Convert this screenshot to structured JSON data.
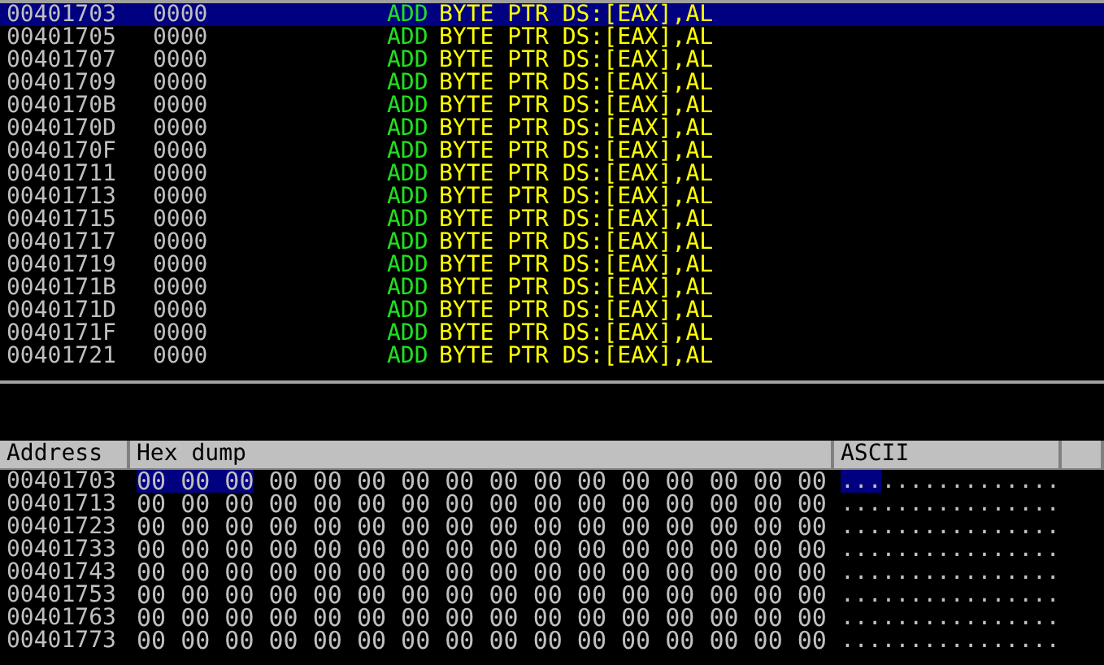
{
  "disassembly": {
    "rows": [
      {
        "address": "00401703",
        "hex": "0000",
        "mnemonic": "ADD",
        "operands": "BYTE PTR DS:[EAX],AL",
        "selected": true
      },
      {
        "address": "00401705",
        "hex": "0000",
        "mnemonic": "ADD",
        "operands": "BYTE PTR DS:[EAX],AL",
        "selected": false
      },
      {
        "address": "00401707",
        "hex": "0000",
        "mnemonic": "ADD",
        "operands": "BYTE PTR DS:[EAX],AL",
        "selected": false
      },
      {
        "address": "00401709",
        "hex": "0000",
        "mnemonic": "ADD",
        "operands": "BYTE PTR DS:[EAX],AL",
        "selected": false
      },
      {
        "address": "0040170B",
        "hex": "0000",
        "mnemonic": "ADD",
        "operands": "BYTE PTR DS:[EAX],AL",
        "selected": false
      },
      {
        "address": "0040170D",
        "hex": "0000",
        "mnemonic": "ADD",
        "operands": "BYTE PTR DS:[EAX],AL",
        "selected": false
      },
      {
        "address": "0040170F",
        "hex": "0000",
        "mnemonic": "ADD",
        "operands": "BYTE PTR DS:[EAX],AL",
        "selected": false
      },
      {
        "address": "00401711",
        "hex": "0000",
        "mnemonic": "ADD",
        "operands": "BYTE PTR DS:[EAX],AL",
        "selected": false
      },
      {
        "address": "00401713",
        "hex": "0000",
        "mnemonic": "ADD",
        "operands": "BYTE PTR DS:[EAX],AL",
        "selected": false
      },
      {
        "address": "00401715",
        "hex": "0000",
        "mnemonic": "ADD",
        "operands": "BYTE PTR DS:[EAX],AL",
        "selected": false
      },
      {
        "address": "00401717",
        "hex": "0000",
        "mnemonic": "ADD",
        "operands": "BYTE PTR DS:[EAX],AL",
        "selected": false
      },
      {
        "address": "00401719",
        "hex": "0000",
        "mnemonic": "ADD",
        "operands": "BYTE PTR DS:[EAX],AL",
        "selected": false
      },
      {
        "address": "0040171B",
        "hex": "0000",
        "mnemonic": "ADD",
        "operands": "BYTE PTR DS:[EAX],AL",
        "selected": false
      },
      {
        "address": "0040171D",
        "hex": "0000",
        "mnemonic": "ADD",
        "operands": "BYTE PTR DS:[EAX],AL",
        "selected": false
      },
      {
        "address": "0040171F",
        "hex": "0000",
        "mnemonic": "ADD",
        "operands": "BYTE PTR DS:[EAX],AL",
        "selected": false
      },
      {
        "address": "00401721",
        "hex": "0000",
        "mnemonic": "ADD",
        "operands": "BYTE PTR DS:[EAX],AL",
        "selected": false
      }
    ]
  },
  "dump": {
    "columns": [
      "Address",
      "Hex dump",
      "ASCII"
    ],
    "rows": [
      {
        "address": "00401703",
        "hex": [
          {
            "text": "00 00 00",
            "selected": true
          },
          {
            "text": "00 00 00 00 00 00 00 00 00 00 00 00 00",
            "selected": false
          }
        ],
        "ascii": [
          {
            "text": "...",
            "selected": true
          },
          {
            "text": ".............",
            "selected": false
          }
        ]
      },
      {
        "address": "00401713",
        "hex": [
          {
            "text": "00 00 00 00 00 00 00 00 00 00 00 00 00 00 00 00",
            "selected": false
          }
        ],
        "ascii": [
          {
            "text": "................",
            "selected": false
          }
        ]
      },
      {
        "address": "00401723",
        "hex": [
          {
            "text": "00 00 00 00 00 00 00 00 00 00 00 00 00 00 00 00",
            "selected": false
          }
        ],
        "ascii": [
          {
            "text": "................",
            "selected": false
          }
        ]
      },
      {
        "address": "00401733",
        "hex": [
          {
            "text": "00 00 00 00 00 00 00 00 00 00 00 00 00 00 00 00",
            "selected": false
          }
        ],
        "ascii": [
          {
            "text": "................",
            "selected": false
          }
        ]
      },
      {
        "address": "00401743",
        "hex": [
          {
            "text": "00 00 00 00 00 00 00 00 00 00 00 00 00 00 00 00",
            "selected": false
          }
        ],
        "ascii": [
          {
            "text": "................",
            "selected": false
          }
        ]
      },
      {
        "address": "00401753",
        "hex": [
          {
            "text": "00 00 00 00 00 00 00 00 00 00 00 00 00 00 00 00",
            "selected": false
          }
        ],
        "ascii": [
          {
            "text": "................",
            "selected": false
          }
        ]
      },
      {
        "address": "00401763",
        "hex": [
          {
            "text": "00 00 00 00 00 00 00 00 00 00 00 00 00 00 00 00",
            "selected": false
          }
        ],
        "ascii": [
          {
            "text": "................",
            "selected": false
          }
        ]
      },
      {
        "address": "00401773",
        "hex": [
          {
            "text": "00 00 00 00 00 00 00 00 00 00 00 00 00 00 00 00",
            "selected": false
          }
        ],
        "ascii": [
          {
            "text": "................",
            "selected": false
          }
        ]
      }
    ]
  }
}
